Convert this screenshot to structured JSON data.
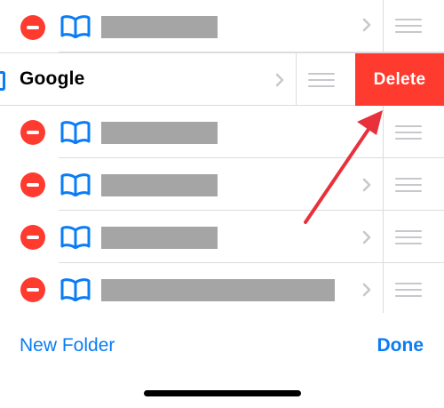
{
  "bookmarks": {
    "swiped_item": {
      "label": "Google"
    },
    "delete_label": "Delete"
  },
  "footer": {
    "new_folder_label": "New Folder",
    "done_label": "Done"
  },
  "colors": {
    "accent": "#0a7cf5",
    "destructive": "#ff3b30",
    "redaction": "#a5a5a5",
    "separator": "#dcdce0"
  },
  "icons": {
    "remove": "minus-circle-icon",
    "bookmark": "book-icon",
    "disclosure": "chevron-right-icon",
    "reorder": "reorder-handle-icon"
  },
  "annotation": "red-arrow-pointing-to-delete"
}
